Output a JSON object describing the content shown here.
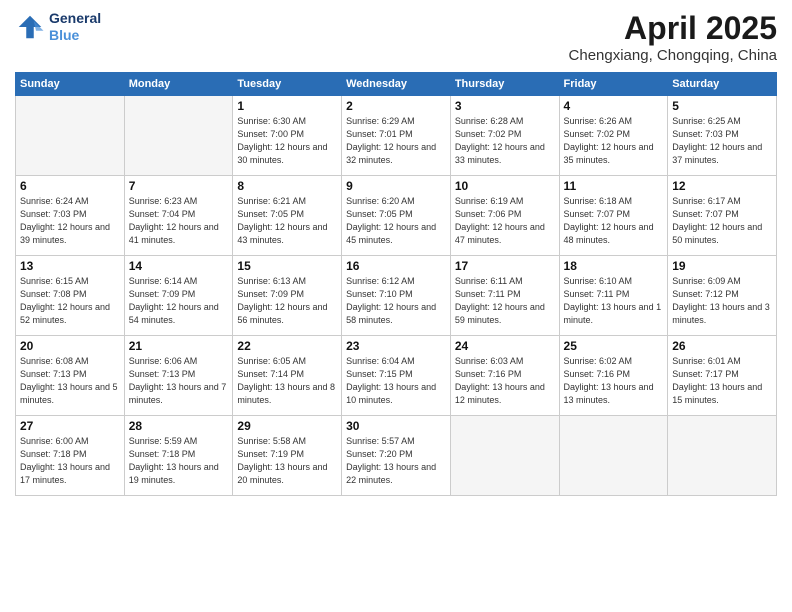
{
  "header": {
    "logo_line1": "General",
    "logo_line2": "Blue",
    "month": "April 2025",
    "location": "Chengxiang, Chongqing, China"
  },
  "weekdays": [
    "Sunday",
    "Monday",
    "Tuesday",
    "Wednesday",
    "Thursday",
    "Friday",
    "Saturday"
  ],
  "weeks": [
    [
      {
        "day": "",
        "empty": true
      },
      {
        "day": "",
        "empty": true
      },
      {
        "day": "1",
        "sunrise": "6:30 AM",
        "sunset": "7:00 PM",
        "daylight": "12 hours and 30 minutes."
      },
      {
        "day": "2",
        "sunrise": "6:29 AM",
        "sunset": "7:01 PM",
        "daylight": "12 hours and 32 minutes."
      },
      {
        "day": "3",
        "sunrise": "6:28 AM",
        "sunset": "7:02 PM",
        "daylight": "12 hours and 33 minutes."
      },
      {
        "day": "4",
        "sunrise": "6:26 AM",
        "sunset": "7:02 PM",
        "daylight": "12 hours and 35 minutes."
      },
      {
        "day": "5",
        "sunrise": "6:25 AM",
        "sunset": "7:03 PM",
        "daylight": "12 hours and 37 minutes."
      }
    ],
    [
      {
        "day": "6",
        "sunrise": "6:24 AM",
        "sunset": "7:03 PM",
        "daylight": "12 hours and 39 minutes."
      },
      {
        "day": "7",
        "sunrise": "6:23 AM",
        "sunset": "7:04 PM",
        "daylight": "12 hours and 41 minutes."
      },
      {
        "day": "8",
        "sunrise": "6:21 AM",
        "sunset": "7:05 PM",
        "daylight": "12 hours and 43 minutes."
      },
      {
        "day": "9",
        "sunrise": "6:20 AM",
        "sunset": "7:05 PM",
        "daylight": "12 hours and 45 minutes."
      },
      {
        "day": "10",
        "sunrise": "6:19 AM",
        "sunset": "7:06 PM",
        "daylight": "12 hours and 47 minutes."
      },
      {
        "day": "11",
        "sunrise": "6:18 AM",
        "sunset": "7:07 PM",
        "daylight": "12 hours and 48 minutes."
      },
      {
        "day": "12",
        "sunrise": "6:17 AM",
        "sunset": "7:07 PM",
        "daylight": "12 hours and 50 minutes."
      }
    ],
    [
      {
        "day": "13",
        "sunrise": "6:15 AM",
        "sunset": "7:08 PM",
        "daylight": "12 hours and 52 minutes."
      },
      {
        "day": "14",
        "sunrise": "6:14 AM",
        "sunset": "7:09 PM",
        "daylight": "12 hours and 54 minutes."
      },
      {
        "day": "15",
        "sunrise": "6:13 AM",
        "sunset": "7:09 PM",
        "daylight": "12 hours and 56 minutes."
      },
      {
        "day": "16",
        "sunrise": "6:12 AM",
        "sunset": "7:10 PM",
        "daylight": "12 hours and 58 minutes."
      },
      {
        "day": "17",
        "sunrise": "6:11 AM",
        "sunset": "7:11 PM",
        "daylight": "12 hours and 59 minutes."
      },
      {
        "day": "18",
        "sunrise": "6:10 AM",
        "sunset": "7:11 PM",
        "daylight": "13 hours and 1 minute."
      },
      {
        "day": "19",
        "sunrise": "6:09 AM",
        "sunset": "7:12 PM",
        "daylight": "13 hours and 3 minutes."
      }
    ],
    [
      {
        "day": "20",
        "sunrise": "6:08 AM",
        "sunset": "7:13 PM",
        "daylight": "13 hours and 5 minutes."
      },
      {
        "day": "21",
        "sunrise": "6:06 AM",
        "sunset": "7:13 PM",
        "daylight": "13 hours and 7 minutes."
      },
      {
        "day": "22",
        "sunrise": "6:05 AM",
        "sunset": "7:14 PM",
        "daylight": "13 hours and 8 minutes."
      },
      {
        "day": "23",
        "sunrise": "6:04 AM",
        "sunset": "7:15 PM",
        "daylight": "13 hours and 10 minutes."
      },
      {
        "day": "24",
        "sunrise": "6:03 AM",
        "sunset": "7:16 PM",
        "daylight": "13 hours and 12 minutes."
      },
      {
        "day": "25",
        "sunrise": "6:02 AM",
        "sunset": "7:16 PM",
        "daylight": "13 hours and 13 minutes."
      },
      {
        "day": "26",
        "sunrise": "6:01 AM",
        "sunset": "7:17 PM",
        "daylight": "13 hours and 15 minutes."
      }
    ],
    [
      {
        "day": "27",
        "sunrise": "6:00 AM",
        "sunset": "7:18 PM",
        "daylight": "13 hours and 17 minutes."
      },
      {
        "day": "28",
        "sunrise": "5:59 AM",
        "sunset": "7:18 PM",
        "daylight": "13 hours and 19 minutes."
      },
      {
        "day": "29",
        "sunrise": "5:58 AM",
        "sunset": "7:19 PM",
        "daylight": "13 hours and 20 minutes."
      },
      {
        "day": "30",
        "sunrise": "5:57 AM",
        "sunset": "7:20 PM",
        "daylight": "13 hours and 22 minutes."
      },
      {
        "day": "",
        "empty": true
      },
      {
        "day": "",
        "empty": true
      },
      {
        "day": "",
        "empty": true
      }
    ]
  ]
}
